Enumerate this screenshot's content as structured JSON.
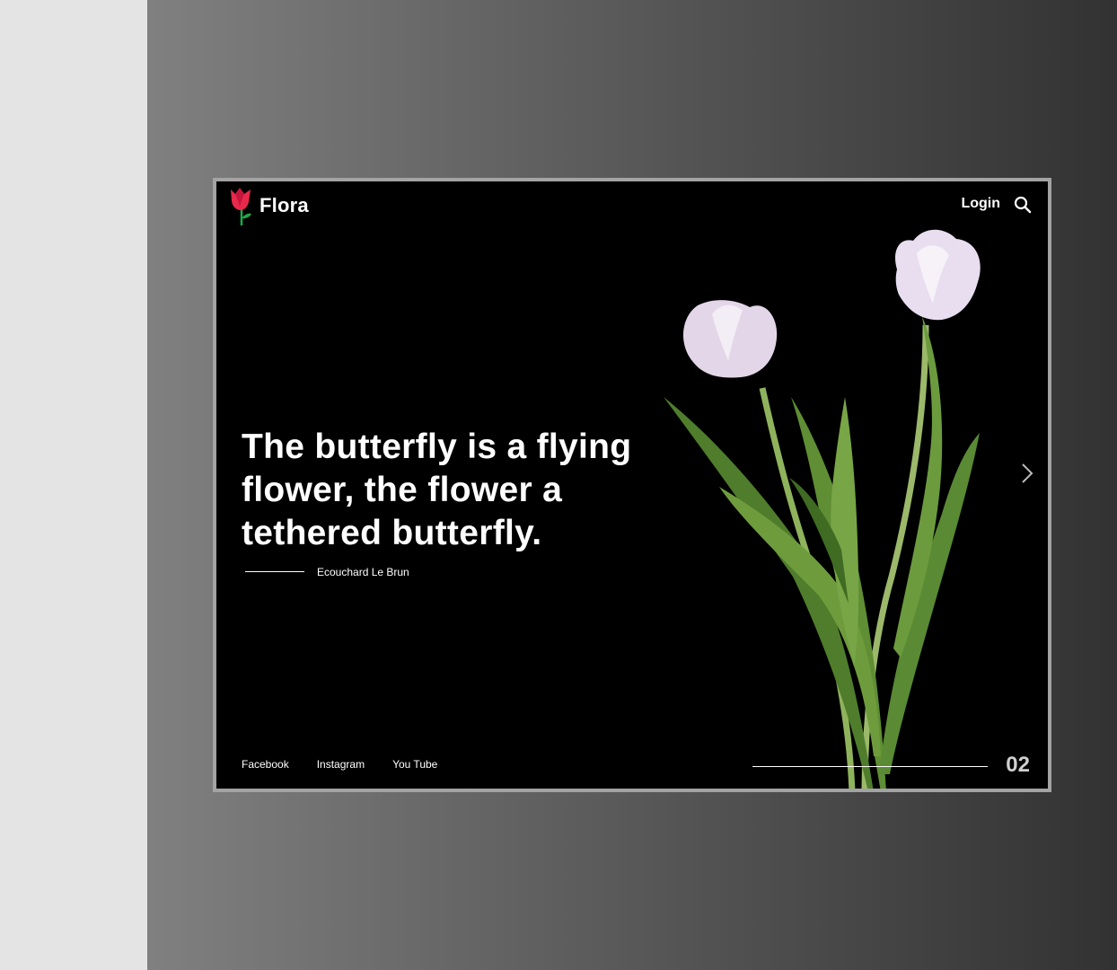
{
  "brand": {
    "name": "Flora",
    "icon": "tulip-logo-icon"
  },
  "nav": {
    "login_label": "Login",
    "search_icon": "search-icon"
  },
  "hero": {
    "quote": "The butterfly is a flying flower, the flower a tethered butterfly.",
    "author": "Ecouchard Le Brun",
    "image": "white-tulips-image"
  },
  "social": [
    {
      "label": "Facebook"
    },
    {
      "label": "Instagram"
    },
    {
      "label": "You Tube"
    }
  ],
  "slider": {
    "current": "02",
    "next_icon": "chevron-right-icon"
  },
  "colors": {
    "background": "#000000",
    "text": "#ffffff",
    "frame_border": "#a3a3a3",
    "logo_petal": "#e8294b",
    "logo_stem": "#1fa84a"
  }
}
